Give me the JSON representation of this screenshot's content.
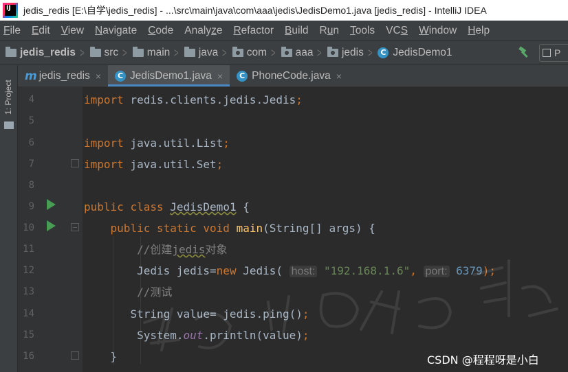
{
  "window": {
    "title": "jedis_redis [E:\\自学\\jedis_redis] - ...\\src\\main\\java\\com\\aaa\\jedis\\JedisDemo1.java [jedis_redis] - IntelliJ IDEA",
    "app_icon_letters": "IJ"
  },
  "menu": [
    {
      "mn": "F",
      "rest": "ile"
    },
    {
      "mn": "E",
      "rest": "dit"
    },
    {
      "mn": "V",
      "rest": "iew"
    },
    {
      "mn": "N",
      "rest": "avigate"
    },
    {
      "mn": "C",
      "rest": "ode"
    },
    {
      "pre": "Analy",
      "mn": "z",
      "rest": "e"
    },
    {
      "mn": "R",
      "rest": "efactor"
    },
    {
      "mn": "B",
      "rest": "uild"
    },
    {
      "pre": "R",
      "mn": "u",
      "rest": "n"
    },
    {
      "mn": "T",
      "rest": "ools"
    },
    {
      "pre": "VC",
      "mn": "S",
      "rest": ""
    },
    {
      "mn": "W",
      "rest": "indow"
    },
    {
      "mn": "H",
      "rest": "elp"
    }
  ],
  "breadcrumbs": [
    "jedis_redis",
    "src",
    "main",
    "java",
    "com",
    "aaa",
    "jedis",
    "JedisDemo1"
  ],
  "run_config_label": "P",
  "tool_stripe": {
    "project_label": "1: Project"
  },
  "tabs": [
    {
      "label": "jedis_redis",
      "icon": "module-m-icon",
      "active": false
    },
    {
      "label": "JedisDemo1.java",
      "icon": "class-icon",
      "active": true
    },
    {
      "label": "PhoneCode.java",
      "icon": "class-icon",
      "active": false
    }
  ],
  "editor": {
    "line_numbers": [
      "4",
      "5",
      "6",
      "7",
      "8",
      "9",
      "10",
      "11",
      "12",
      "13",
      "14",
      "15",
      "16"
    ],
    "code": {
      "l4": {
        "kw": "import",
        "rest": " redis.clients.jedis.Jedis",
        "semi": ";"
      },
      "l6": {
        "kw": "import",
        "rest": " java.util.List",
        "semi": ";"
      },
      "l7": {
        "kw": "import",
        "rest": " java.util.Set",
        "semi": ";"
      },
      "l9": {
        "kw1": "public",
        "kw2": "class",
        "name": "JedisDemo1",
        "brace": "{"
      },
      "l10": {
        "kw1": "public",
        "kw2": "static",
        "kw3": "void",
        "fn": "main",
        "params": "(String[] args) ",
        "brace": "{"
      },
      "l11": {
        "comment_a": "//创建",
        "comment_b": "jedis",
        "comment_c": "对象"
      },
      "l12": {
        "type": "Jedis",
        "var": " jedis=",
        "kw": "new",
        "ctor": " Jedis(",
        "hint_host": "host:",
        "str": "\"192.168.1.6\"",
        "comma": ",",
        "hint_port": "port:",
        "num": "6379",
        "end": ");"
      },
      "l13": {
        "comment": "//测试"
      },
      "l14": {
        "pre": "String value= jedis.ping()",
        "semi": ";"
      },
      "l15": {
        "pre": "System.",
        "it": "out",
        "post": ".println(value)",
        "semi": ";"
      },
      "l16": {
        "brace": "}"
      }
    }
  },
  "watermark": {
    "csdn": "CSDN @程程呀是小白"
  }
}
